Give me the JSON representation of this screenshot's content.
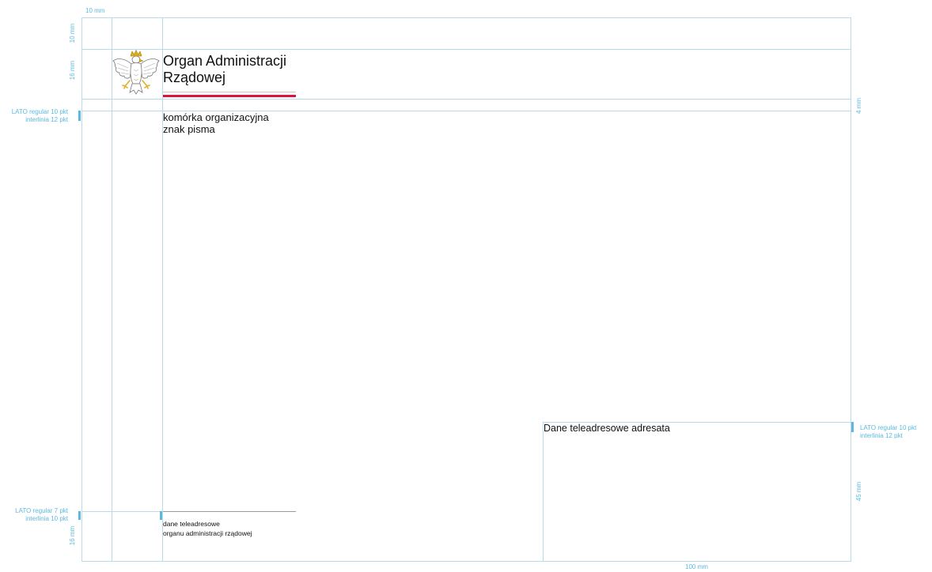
{
  "document": {
    "org_name_line1": "Organ Administracji",
    "org_name_line2": "Rządowej",
    "unit": "komórka organizacyjna",
    "reference": "znak pisma",
    "footer_line1": "dane teleadresowe",
    "footer_line2": "organu administracji rządowej",
    "recipient": "Dane teleadresowe adresata"
  },
  "annotations": {
    "top_margin_width": "10 mm",
    "top_margin_height": "10 mm",
    "header_height": "16 mm",
    "gap_right": "4 mm",
    "body_font_line1": "LATO regular 10 pkt",
    "body_font_line2": "interlinia 12 pkt",
    "footer_font_line1": "LATO regular 7 pkt",
    "footer_font_line2": "interlinia 10 pkt",
    "footer_height": "16 mm",
    "recipient_font_line1": "LATO regular 10 pkt",
    "recipient_font_line2": "interlinia 12 pkt",
    "recipient_height": "45 mm",
    "recipient_width": "100 mm"
  },
  "colors": {
    "guide": "#b9dced",
    "annotation": "#5db8e0",
    "flag_red": "#dc143c",
    "eagle_gold": "#e0b020"
  },
  "icons": {
    "emblem": "polish-white-eagle-emblem-icon"
  }
}
